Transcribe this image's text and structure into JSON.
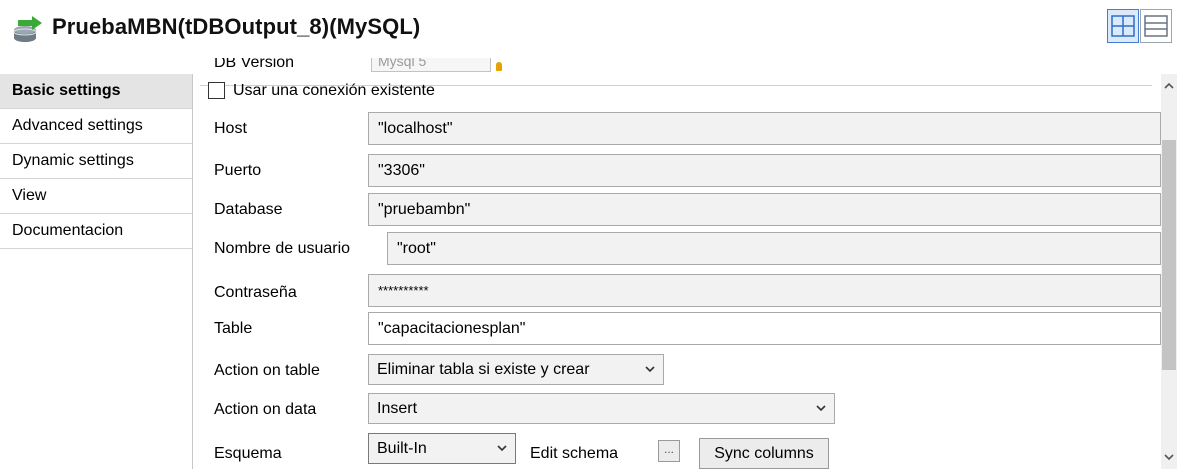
{
  "window": {
    "title": "PruebaMBN(tDBOutput_8)(MySQL)"
  },
  "sidebar": {
    "items": [
      {
        "label": "Basic settings",
        "active": true
      },
      {
        "label": "Advanced settings",
        "active": false
      },
      {
        "label": "Dynamic settings",
        "active": false
      },
      {
        "label": "View",
        "active": false
      },
      {
        "label": "Documentacion",
        "active": false
      }
    ]
  },
  "form": {
    "db_version": {
      "label": "DB Version",
      "value": "Mysql 5"
    },
    "use_existing_connection": {
      "label": "Usar una conexión existente",
      "checked": false
    },
    "host": {
      "label": "Host",
      "value": "\"localhost\""
    },
    "port": {
      "label": "Puerto",
      "value": "\"3306\""
    },
    "database": {
      "label": "Database",
      "value": "\"pruebambn\""
    },
    "username": {
      "label": "Nombre de usuario",
      "value": "\"root\""
    },
    "password": {
      "label": "Contraseña",
      "value": "**********"
    },
    "table": {
      "label": "Table",
      "value": "\"capacitacionesplan\""
    },
    "action_on_table": {
      "label": "Action on table",
      "value": "Eliminar tabla si existe y crear"
    },
    "action_on_data": {
      "label": "Action on data",
      "value": "Insert"
    },
    "schema": {
      "label": "Esquema",
      "value": "Built-In",
      "edit_label": "Edit schema",
      "ellipsis": "...",
      "sync_label": "Sync columns"
    }
  },
  "icons": {
    "dropdown": "chevron-down-icon",
    "title": "db-output-icon",
    "colors": {
      "accent": "#3e7fd1",
      "icon_green": "#3aa935",
      "icon_gray": "#6d7b86"
    }
  }
}
